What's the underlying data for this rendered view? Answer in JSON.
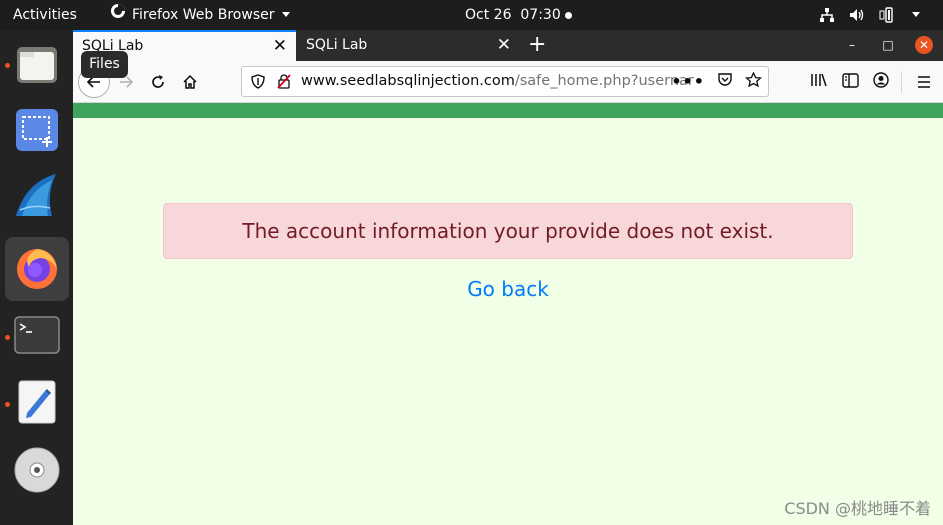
{
  "topbar": {
    "activities": "Activities",
    "app_name": "Firefox Web Browser",
    "date": "Oct 26",
    "time": "07:30"
  },
  "dock": {
    "items": [
      {
        "icon": "files-icon",
        "running": true,
        "active": false
      },
      {
        "icon": "screenshot-icon",
        "running": false,
        "active": false
      },
      {
        "icon": "wireshark-icon",
        "running": false,
        "active": false
      },
      {
        "icon": "firefox-icon",
        "running": true,
        "active": true
      },
      {
        "icon": "terminal-icon",
        "running": true,
        "active": false
      },
      {
        "icon": "text-editor-icon",
        "running": true,
        "active": false
      },
      {
        "icon": "disc-icon",
        "running": false,
        "active": false
      }
    ]
  },
  "tooltip": "Files",
  "browser": {
    "tabs": [
      {
        "title": "SQLi Lab",
        "active": true
      },
      {
        "title": "SQLi Lab",
        "active": false
      }
    ],
    "url_domain": "www.seedlabsqlinjection.com",
    "url_path": "/safe_home.php?usernan"
  },
  "page": {
    "alert": "The account information your provide does not exist.",
    "link": "Go back"
  },
  "watermark": "CSDN @桃地睡不着",
  "colors": {
    "green_bar": "#3fa55c",
    "page_bg": "#f0ffe6",
    "alert_bg": "#f8d7da",
    "alert_text": "#721c24",
    "link": "#007bff",
    "accent": "#e95420"
  }
}
